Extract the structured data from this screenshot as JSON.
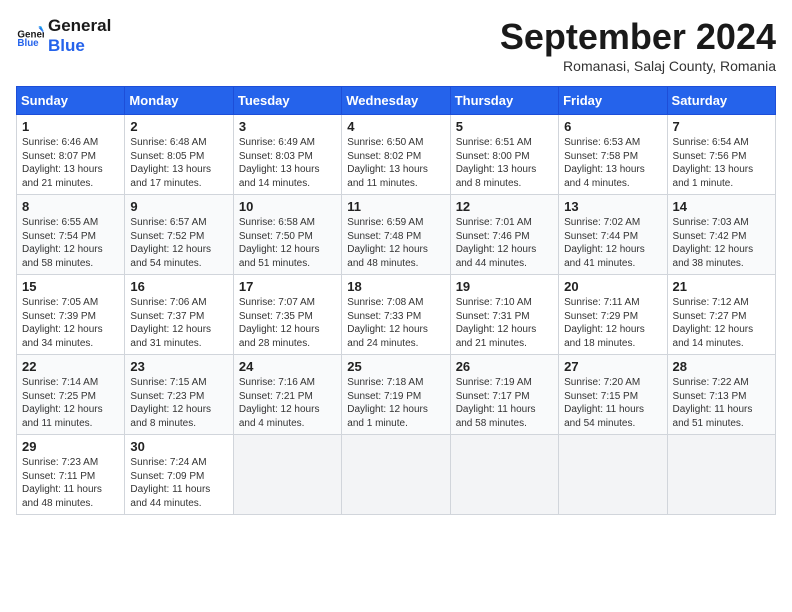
{
  "app": {
    "name": "GeneralBlue",
    "title": "September 2024",
    "location": "Romanasi, Salaj County, Romania"
  },
  "calendar": {
    "headers": [
      "Sunday",
      "Monday",
      "Tuesday",
      "Wednesday",
      "Thursday",
      "Friday",
      "Saturday"
    ],
    "rows": [
      [
        {
          "day": "1",
          "sunrise": "6:46 AM",
          "sunset": "8:07 PM",
          "daylight": "13 hours and 21 minutes."
        },
        {
          "day": "2",
          "sunrise": "6:48 AM",
          "sunset": "8:05 PM",
          "daylight": "13 hours and 17 minutes."
        },
        {
          "day": "3",
          "sunrise": "6:49 AM",
          "sunset": "8:03 PM",
          "daylight": "13 hours and 14 minutes."
        },
        {
          "day": "4",
          "sunrise": "6:50 AM",
          "sunset": "8:02 PM",
          "daylight": "13 hours and 11 minutes."
        },
        {
          "day": "5",
          "sunrise": "6:51 AM",
          "sunset": "8:00 PM",
          "daylight": "13 hours and 8 minutes."
        },
        {
          "day": "6",
          "sunrise": "6:53 AM",
          "sunset": "7:58 PM",
          "daylight": "13 hours and 4 minutes."
        },
        {
          "day": "7",
          "sunrise": "6:54 AM",
          "sunset": "7:56 PM",
          "daylight": "13 hours and 1 minute."
        }
      ],
      [
        {
          "day": "8",
          "sunrise": "6:55 AM",
          "sunset": "7:54 PM",
          "daylight": "12 hours and 58 minutes."
        },
        {
          "day": "9",
          "sunrise": "6:57 AM",
          "sunset": "7:52 PM",
          "daylight": "12 hours and 54 minutes."
        },
        {
          "day": "10",
          "sunrise": "6:58 AM",
          "sunset": "7:50 PM",
          "daylight": "12 hours and 51 minutes."
        },
        {
          "day": "11",
          "sunrise": "6:59 AM",
          "sunset": "7:48 PM",
          "daylight": "12 hours and 48 minutes."
        },
        {
          "day": "12",
          "sunrise": "7:01 AM",
          "sunset": "7:46 PM",
          "daylight": "12 hours and 44 minutes."
        },
        {
          "day": "13",
          "sunrise": "7:02 AM",
          "sunset": "7:44 PM",
          "daylight": "12 hours and 41 minutes."
        },
        {
          "day": "14",
          "sunrise": "7:03 AM",
          "sunset": "7:42 PM",
          "daylight": "12 hours and 38 minutes."
        }
      ],
      [
        {
          "day": "15",
          "sunrise": "7:05 AM",
          "sunset": "7:39 PM",
          "daylight": "12 hours and 34 minutes."
        },
        {
          "day": "16",
          "sunrise": "7:06 AM",
          "sunset": "7:37 PM",
          "daylight": "12 hours and 31 minutes."
        },
        {
          "day": "17",
          "sunrise": "7:07 AM",
          "sunset": "7:35 PM",
          "daylight": "12 hours and 28 minutes."
        },
        {
          "day": "18",
          "sunrise": "7:08 AM",
          "sunset": "7:33 PM",
          "daylight": "12 hours and 24 minutes."
        },
        {
          "day": "19",
          "sunrise": "7:10 AM",
          "sunset": "7:31 PM",
          "daylight": "12 hours and 21 minutes."
        },
        {
          "day": "20",
          "sunrise": "7:11 AM",
          "sunset": "7:29 PM",
          "daylight": "12 hours and 18 minutes."
        },
        {
          "day": "21",
          "sunrise": "7:12 AM",
          "sunset": "7:27 PM",
          "daylight": "12 hours and 14 minutes."
        }
      ],
      [
        {
          "day": "22",
          "sunrise": "7:14 AM",
          "sunset": "7:25 PM",
          "daylight": "12 hours and 11 minutes."
        },
        {
          "day": "23",
          "sunrise": "7:15 AM",
          "sunset": "7:23 PM",
          "daylight": "12 hours and 8 minutes."
        },
        {
          "day": "24",
          "sunrise": "7:16 AM",
          "sunset": "7:21 PM",
          "daylight": "12 hours and 4 minutes."
        },
        {
          "day": "25",
          "sunrise": "7:18 AM",
          "sunset": "7:19 PM",
          "daylight": "12 hours and 1 minute."
        },
        {
          "day": "26",
          "sunrise": "7:19 AM",
          "sunset": "7:17 PM",
          "daylight": "11 hours and 58 minutes."
        },
        {
          "day": "27",
          "sunrise": "7:20 AM",
          "sunset": "7:15 PM",
          "daylight": "11 hours and 54 minutes."
        },
        {
          "day": "28",
          "sunrise": "7:22 AM",
          "sunset": "7:13 PM",
          "daylight": "11 hours and 51 minutes."
        }
      ],
      [
        {
          "day": "29",
          "sunrise": "7:23 AM",
          "sunset": "7:11 PM",
          "daylight": "11 hours and 48 minutes."
        },
        {
          "day": "30",
          "sunrise": "7:24 AM",
          "sunset": "7:09 PM",
          "daylight": "11 hours and 44 minutes."
        },
        null,
        null,
        null,
        null,
        null
      ]
    ]
  }
}
